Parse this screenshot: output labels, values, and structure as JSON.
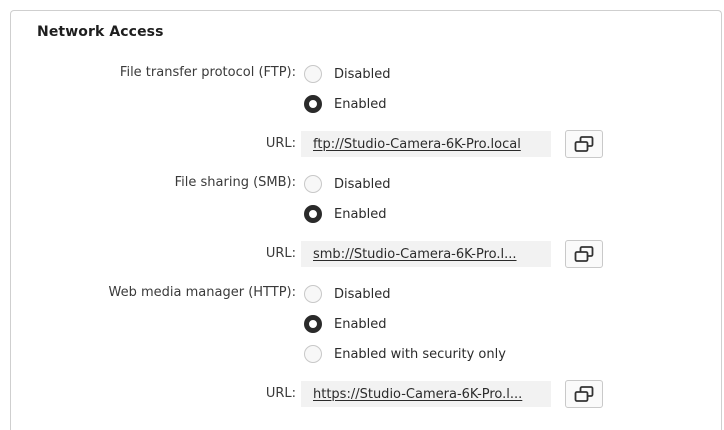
{
  "section": {
    "title": "Network Access"
  },
  "ftp": {
    "label": "File transfer protocol (FTP):",
    "options": [
      "Disabled",
      "Enabled"
    ],
    "selected": "Enabled",
    "url_label": "URL:",
    "url": "ftp://Studio-Camera-6K-Pro.local"
  },
  "smb": {
    "label": "File sharing (SMB):",
    "options": [
      "Disabled",
      "Enabled"
    ],
    "selected": "Enabled",
    "url_label": "URL:",
    "url": "smb://Studio-Camera-6K-Pro.l..."
  },
  "http": {
    "label": "Web media manager (HTTP):",
    "options": [
      "Disabled",
      "Enabled",
      "Enabled with security only"
    ],
    "selected": "Enabled",
    "url_label": "URL:",
    "url": "https://Studio-Camera-6K-Pro.l..."
  },
  "icons": {
    "copy": "copy-icon"
  },
  "colors": {
    "radio_checked": "#2a2a2a",
    "url_field_bg": "#f2f2f2"
  }
}
